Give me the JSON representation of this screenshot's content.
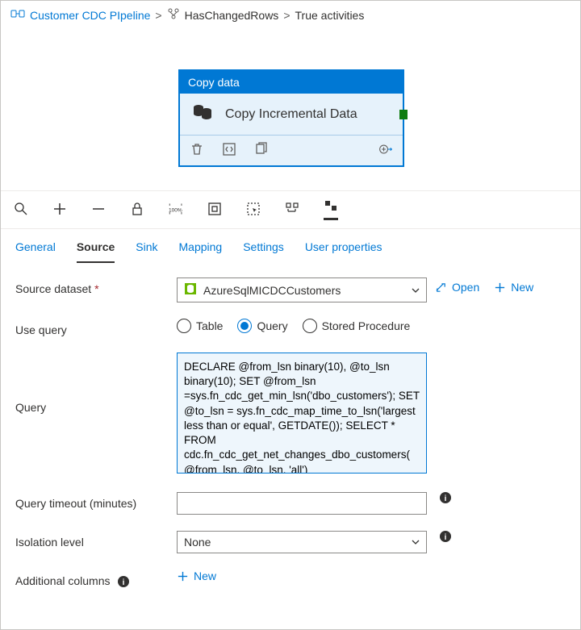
{
  "breadcrumb": {
    "root": "Customer CDC PIpeline",
    "sep": ">",
    "mid": "HasChangedRows",
    "leaf": "True activities"
  },
  "activity": {
    "type_label": "Copy data",
    "name": "Copy Incremental Data"
  },
  "tabs": [
    "General",
    "Source",
    "Sink",
    "Mapping",
    "Settings",
    "User properties"
  ],
  "active_tab_index": 1,
  "form": {
    "source_dataset_label": "Source dataset",
    "source_dataset_value": "AzureSqlMICDCCustomers",
    "open_label": "Open",
    "new_label": "New",
    "use_query_label": "Use query",
    "use_query_options": [
      "Table",
      "Query",
      "Stored Procedure"
    ],
    "use_query_selected_index": 1,
    "query_label": "Query",
    "query_value": "DECLARE @from_lsn binary(10), @to_lsn binary(10); SET @from_lsn =sys.fn_cdc_get_min_lsn('dbo_customers'); SET @to_lsn = sys.fn_cdc_map_time_to_lsn('largest less than or equal', GETDATE()); SELECT * FROM cdc.fn_cdc_get_net_changes_dbo_customers(@from_lsn, @to_lsn, 'all')",
    "timeout_label": "Query timeout (minutes)",
    "timeout_value": "",
    "isolation_label": "Isolation level",
    "isolation_value": "None",
    "additional_cols_label": "Additional columns",
    "additional_cols_new": "New"
  }
}
